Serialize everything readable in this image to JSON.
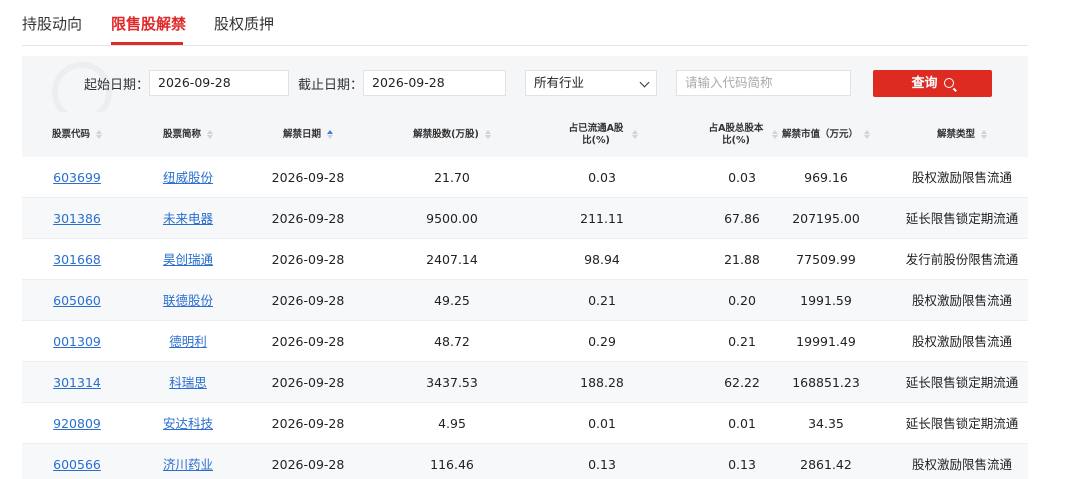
{
  "tabs": [
    "持股动向",
    "限售股解禁",
    "股权质押"
  ],
  "active_tab": "限售股解禁",
  "filter": {
    "start_label": "起始日期：",
    "start_value": "2026-09-28",
    "end_label": "截止日期：",
    "end_value": "2026-09-28",
    "industry_value": "所有行业",
    "code_placeholder": "请输入代码简称",
    "query_label": "查询"
  },
  "colors": {
    "accent": "#de2b22",
    "link": "#2a6fcf"
  },
  "table": {
    "headers": [
      {
        "label": "股票代码",
        "sort": "none"
      },
      {
        "label": "股票简称",
        "sort": "none"
      },
      {
        "label": "解禁日期",
        "sort": "asc"
      },
      {
        "label": "解禁股数(万股)",
        "sort": "none"
      },
      {
        "label": "占已流通A股比(%)",
        "sort": "none"
      },
      {
        "label": "占A股总股本比(%)",
        "sort": "none"
      },
      {
        "label": "解禁市值（万元）",
        "sort": "none"
      },
      {
        "label": "解禁类型",
        "sort": "none"
      }
    ],
    "rows": [
      [
        "603699",
        "纽威股份",
        "2026-09-28",
        "21.70",
        "0.03",
        "0.03",
        "969.16",
        "股权激励限售流通"
      ],
      [
        "301386",
        "未来电器",
        "2026-09-28",
        "9500.00",
        "211.11",
        "67.86",
        "207195.00",
        "延长限售锁定期流通"
      ],
      [
        "301668",
        "昊创瑞通",
        "2026-09-28",
        "2407.14",
        "98.94",
        "21.88",
        "77509.99",
        "发行前股份限售流通"
      ],
      [
        "605060",
        "联德股份",
        "2026-09-28",
        "49.25",
        "0.21",
        "0.20",
        "1991.59",
        "股权激励限售流通"
      ],
      [
        "001309",
        "德明利",
        "2026-09-28",
        "48.72",
        "0.29",
        "0.21",
        "19991.49",
        "股权激励限售流通"
      ],
      [
        "301314",
        "科瑞思",
        "2026-09-28",
        "3437.53",
        "188.28",
        "62.22",
        "168851.23",
        "延长限售锁定期流通"
      ],
      [
        "920809",
        "安达科技",
        "2026-09-28",
        "4.95",
        "0.01",
        "0.01",
        "34.35",
        "延长限售锁定期流通"
      ],
      [
        "600566",
        "济川药业",
        "2026-09-28",
        "116.46",
        "0.13",
        "0.13",
        "2861.42",
        "股权激励限售流通"
      ]
    ]
  }
}
